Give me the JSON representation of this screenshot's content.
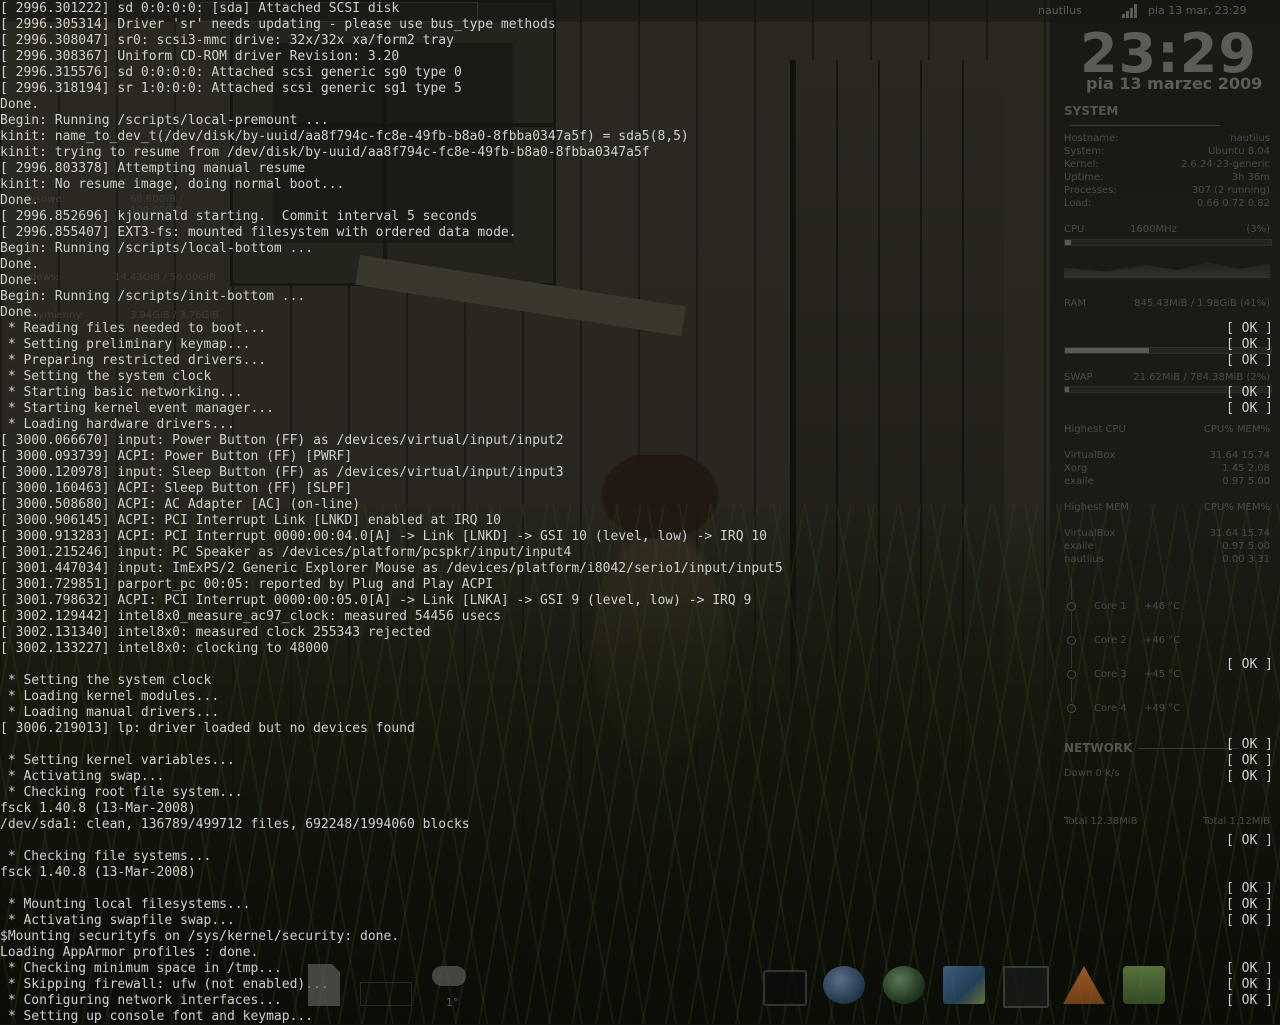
{
  "top_panel": {
    "tasklist_ghost": "",
    "hostname": "nautilus",
    "clock": "pia 13 mar, 23:29"
  },
  "console": {
    "lines": [
      "[ 2996.301222] sd 0:0:0:0: [sda] Attached SCSI disk",
      "[ 2996.305314] Driver 'sr' needs updating - please use bus_type methods",
      "[ 2996.308047] sr0: scsi3-mmc drive: 32x/32x xa/form2 tray",
      "[ 2996.308367] Uniform CD-ROM driver Revision: 3.20",
      "[ 2996.315576] sd 0:0:0:0: Attached scsi generic sg0 type 0",
      "[ 2996.318194] sr 1:0:0:0: Attached scsi generic sg1 type 5",
      "Done.",
      "Begin: Running /scripts/local-premount ...",
      "kinit: name_to_dev_t(/dev/disk/by-uuid/aa8f794c-fc8e-49fb-b8a0-8fbba0347a5f) = sda5(8,5)",
      "kinit: trying to resume from /dev/disk/by-uuid/aa8f794c-fc8e-49fb-b8a0-8fbba0347a5f",
      "[ 2996.803378] Attempting manual resume",
      "kinit: No resume image, doing normal boot...",
      "Done.",
      "[ 2996.852696] kjournald starting.  Commit interval 5 seconds",
      "[ 2996.855407] EXT3-fs: mounted filesystem with ordered data mode.",
      "Begin: Running /scripts/local-bottom ...",
      "Done.",
      "Done.",
      "Begin: Running /scripts/init-bottom ...",
      "Done.",
      " * Reading files needed to boot...",
      " * Setting preliminary keymap...",
      " * Preparing restricted drivers...",
      " * Setting the system clock",
      " * Starting basic networking...",
      " * Starting kernel event manager...",
      " * Loading hardware drivers...",
      "[ 3000.066670] input: Power Button (FF) as /devices/virtual/input/input2",
      "[ 3000.093739] ACPI: Power Button (FF) [PWRF]",
      "[ 3000.120978] input: Sleep Button (FF) as /devices/virtual/input/input3",
      "[ 3000.160463] ACPI: Sleep Button (FF) [SLPF]",
      "[ 3000.508680] ACPI: AC Adapter [AC] (on-line)",
      "[ 3000.906145] ACPI: PCI Interrupt Link [LNKD] enabled at IRQ 10",
      "[ 3000.913283] ACPI: PCI Interrupt 0000:00:04.0[A] -> Link [LNKD] -> GSI 10 (level, low) -> IRQ 10",
      "[ 3001.215246] input: PC Speaker as /devices/platform/pcspkr/input/input4",
      "[ 3001.447034] input: ImExPS/2 Generic Explorer Mouse as /devices/platform/i8042/serio1/input/input5",
      "[ 3001.729851] parport_pc 00:05: reported by Plug and Play ACPI",
      "[ 3001.798632] ACPI: PCI Interrupt 0000:00:05.0[A] -> Link [LNKA] -> GSI 9 (level, low) -> IRQ 9",
      "[ 3002.129442] intel8x0_measure_ac97_clock: measured 54456 usecs",
      "[ 3002.131340] intel8x0: measured clock 255343 rejected",
      "[ 3002.133227] intel8x0: clocking to 48000",
      "",
      " * Setting the system clock",
      " * Loading kernel modules...",
      " * Loading manual drivers...",
      "[ 3006.219013] lp: driver loaded but no devices found",
      "",
      " * Setting kernel variables...",
      " * Activating swap...",
      " * Checking root file system...",
      "fsck 1.40.8 (13-Mar-2008)",
      "/dev/sda1: clean, 136789/499712 files, 692248/1994060 blocks",
      "",
      " * Checking file systems...",
      "fsck 1.40.8 (13-Mar-2008)",
      "",
      " * Mounting local filesystems...",
      " * Activating swapfile swap...",
      "$Mounting securityfs on /sys/kernel/security: done.",
      "Loading AppArmor profiles : done.",
      " * Checking minimum space in /tmp...",
      " * Skipping firewall: ufw (not enabled)...",
      " * Configuring network interfaces...",
      " * Setting up console font and keymap..."
    ],
    "ok_label": "[ OK ]",
    "ok_rows": [
      20,
      21,
      22,
      24,
      25,
      41,
      46,
      47,
      48,
      52,
      55,
      56,
      57,
      60,
      61,
      62
    ]
  },
  "conky": {
    "clock": "23:29",
    "date": "pia 13 marzec 2009",
    "system_header": "SYSTEM",
    "system": [
      {
        "k": "Hostname:",
        "v": "nautilus"
      },
      {
        "k": "System:",
        "v": "Ubuntu 8.04"
      },
      {
        "k": "Kernel:",
        "v": "2.6.24-23-generic"
      },
      {
        "k": "Uptime:",
        "v": "3h 36m"
      },
      {
        "k": "Processes:",
        "v": "307 (2 running)"
      },
      {
        "k": "Load:",
        "v": "0.66 0.72 0.82"
      }
    ],
    "cpu": {
      "label": "CPU",
      "freq": "1600MHz",
      "pct": "(3%)",
      "fill": 0.03
    },
    "ram": {
      "label": "RAM",
      "value": "845.43MiB / 1.98GiB (41%)",
      "fill": 0.41
    },
    "swap": {
      "label": "SWAP",
      "value": "21.62MiB / 784.38MiB (2%)",
      "fill": 0.02
    },
    "highest_cpu": {
      "header": "Highest CPU",
      "cols": "CPU% MEM%",
      "rows": [
        {
          "k": "VirtualBox",
          "v": "31.64 15.74"
        },
        {
          "k": "Xorg",
          "v": "1.45  2.08"
        },
        {
          "k": "exaile",
          "v": "0.97  5.00"
        }
      ]
    },
    "highest_mem": {
      "header": "Highest MEM",
      "cols": "CPU% MEM%",
      "rows": [
        {
          "k": "VirtualBox",
          "v": "31.64 15.74"
        },
        {
          "k": "exaile",
          "v": "0.97  5.00"
        },
        {
          "k": "nautilus",
          "v": "0.00  3.31"
        }
      ]
    },
    "cores": [
      {
        "name": "Core 1",
        "temp": "+46 °C"
      },
      {
        "name": "Core 2",
        "temp": "+46 °C"
      },
      {
        "name": "Core 3",
        "temp": "+45 °C"
      },
      {
        "name": "Core 4",
        "temp": "+49 °C"
      }
    ],
    "network_header": "NETWORK",
    "down": "Down 0 k/s",
    "total_down": "Total 12.38MiB",
    "total_up": "Total 1.12MiB"
  },
  "desktop": {
    "weather_temp": "1°",
    "disk_labels": [
      {
        "k": "ysowe:",
        "v": "68.60GiB / 100.00GiB"
      },
      {
        "k": "dows:",
        "v": "14.43GiB / 50.00GiB"
      },
      {
        "k": "wymienny:",
        "v": "3.94GiB / 3.76GiB"
      }
    ]
  },
  "dock": {
    "icons": [
      "terminal-icon",
      "browser-icon",
      "globe-icon",
      "virtualbox-icon",
      "system-monitor-icon",
      "vlc-icon",
      "package-icon"
    ]
  }
}
